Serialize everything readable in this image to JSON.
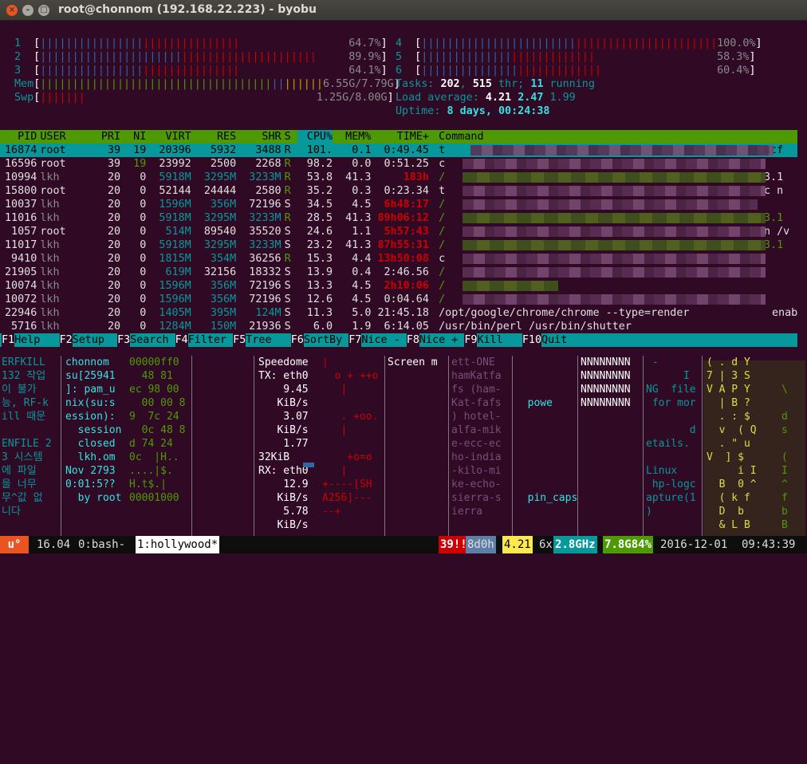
{
  "window": {
    "title": "root@chonnom (192.168.22.223) - byobu"
  },
  "cpu_meters": [
    {
      "label": "1",
      "value": "64.7%",
      "fill": 0.647
    },
    {
      "label": "2",
      "value": "89.9%",
      "fill": 0.899
    },
    {
      "label": "3",
      "value": "64.1%",
      "fill": 0.641
    },
    {
      "label": "4",
      "value": "100.0%",
      "fill": 1.0
    },
    {
      "label": "5",
      "value": "58.3%",
      "fill": 0.583
    },
    {
      "label": "6",
      "value": "60.4%",
      "fill": 0.604
    }
  ],
  "mem": {
    "label": "Mem",
    "value": "6.55G/7.79G"
  },
  "swp": {
    "label": "Swp",
    "value": "1.25G/8.00G"
  },
  "tasks": {
    "label": "Tasks:",
    "count": "202",
    "sep": ",",
    "thr": "515",
    "thr_label": "thr;",
    "running": "11",
    "running_label": "running"
  },
  "load": {
    "label": "Load average:",
    "v1": "4.21",
    "v2": "2.47",
    "v3": "1.99"
  },
  "uptime": {
    "label": "Uptime:",
    "value": "8 days, 00:24:38"
  },
  "columns": [
    "PID",
    "USER",
    "PRI",
    "NI",
    "VIRT",
    "RES",
    "SHR",
    "S",
    "CPU%",
    "MEM%",
    "TIME+",
    "Command"
  ],
  "processes": [
    [
      "16874",
      "root",
      "39",
      "19",
      "20396",
      "5932",
      "3488",
      "R",
      "101.",
      "0.1",
      "0:49.45",
      "t"
    ],
    [
      "16596",
      "root",
      "39",
      "19",
      "23992",
      "2500",
      "2268",
      "R",
      "98.2",
      "0.0",
      "0:51.25",
      "c"
    ],
    [
      "10994",
      "lkh",
      "20",
      "0",
      "5918M",
      "3295M",
      "3233M",
      "R",
      "53.8",
      "41.3",
      "183h",
      "/"
    ],
    [
      "15800",
      "root",
      "20",
      "0",
      "52144",
      "24444",
      "2580",
      "R",
      "35.2",
      "0.3",
      "0:23.34",
      "t"
    ],
    [
      "10037",
      "lkh",
      "20",
      "0",
      "1596M",
      "356M",
      "72196",
      "S",
      "34.5",
      "4.5",
      "6h48:17",
      "/"
    ],
    [
      "11016",
      "lkh",
      "20",
      "0",
      "5918M",
      "3295M",
      "3233M",
      "R",
      "28.5",
      "41.3",
      "89h06:12",
      "/"
    ],
    [
      "1057",
      "root",
      "20",
      "0",
      "514M",
      "89540",
      "35520",
      "S",
      "24.6",
      "1.1",
      "5h57:43",
      "/"
    ],
    [
      "11017",
      "lkh",
      "20",
      "0",
      "5918M",
      "3295M",
      "3233M",
      "S",
      "23.2",
      "41.3",
      "87h55:31",
      "/"
    ],
    [
      "9410",
      "lkh",
      "20",
      "0",
      "1815M",
      "354M",
      "36256",
      "R",
      "15.3",
      "4.4",
      "13h50:08",
      "c"
    ],
    [
      "21905",
      "lkh",
      "20",
      "0",
      "619M",
      "32156",
      "18332",
      "S",
      "13.9",
      "0.4",
      "2:46.56",
      "/"
    ],
    [
      "10074",
      "lkh",
      "20",
      "0",
      "1596M",
      "356M",
      "72196",
      "S",
      "13.3",
      "4.5",
      "2h10:06",
      "/"
    ],
    [
      "10072",
      "lkh",
      "20",
      "0",
      "1596M",
      "356M",
      "72196",
      "S",
      "12.6",
      "4.5",
      "0:04.64",
      "/"
    ],
    [
      "22946",
      "lkh",
      "20",
      "0",
      "1405M",
      "395M",
      "124M",
      "S",
      "11.3",
      "5.0",
      "21:45.18",
      "/opt/google/chrome/chrome --type=render"
    ],
    [
      "5716",
      "lkh",
      "20",
      "0",
      "1284M",
      "150M",
      "21936",
      "S",
      "6.0",
      "1.9",
      "6:14.05",
      "/usr/bin/perl /usr/bin/shutter"
    ]
  ],
  "right_tail": {
    "r0": "utf",
    "r2": "3.1",
    "r3": "c n",
    "r5": "3.1",
    "r6": "n /v",
    "r7": "3.1",
    "r12": "enab"
  },
  "fkeys": [
    {
      "key": "F1",
      "label": "Help"
    },
    {
      "key": "F2",
      "label": "Setup"
    },
    {
      "key": "F3",
      "label": "Search"
    },
    {
      "key": "F4",
      "label": "Filter"
    },
    {
      "key": "F5",
      "label": "Tree"
    },
    {
      "key": "F6",
      "label": "SortBy"
    },
    {
      "key": "F7",
      "label": "Nice -"
    },
    {
      "key": "F8",
      "label": "Nice +"
    },
    {
      "key": "F9",
      "label": "Kill"
    },
    {
      "key": "F10",
      "label": "Quit"
    }
  ],
  "panels": {
    "p1": [
      "ERFKILL",
      "132 작업",
      "이 불가",
      "능, RF-k",
      "ill 때문",
      "",
      "ENFILE 2",
      "3 시스템",
      "에 파일",
      "을 너무",
      "무^값 없",
      "니다"
    ],
    "p2": [
      "chonnom",
      "su[25941",
      "]: pam_u",
      "nix(su:s",
      "ession):",
      "  session",
      "  closed",
      "  lkh.om",
      "Nov 2793",
      "0:01:5??",
      "  by root"
    ],
    "p3": [
      "00000ff0",
      "  48 81",
      "ec 98 00",
      "  00 00 8",
      "9  7c 24",
      "  0c 48 8",
      "d 74 24",
      "0c  |H..",
      "....|$.",
      "H.t$.|",
      "00001000"
    ],
    "p4": [
      "Speedome",
      "TX: eth0",
      "    9.45",
      "   KiB/s",
      "    3.07",
      "   KiB/s",
      "    1.77",
      "32KiB",
      "RX: eth0",
      "    12.9",
      "   KiB/s",
      "    5.78",
      "   KiB/s"
    ],
    "p5": [
      "|",
      "  o + ++o",
      "   |",
      "",
      "   . +oo.",
      "   |",
      "",
      "    +o=o",
      "   |",
      "+----[SH",
      "A256]---",
      "--+"
    ],
    "p6": [
      "Screen m"
    ],
    "p7": [
      "ett-ONE",
      "hamKatfa",
      "fs (ham-",
      "Kat-fafs",
      ") hotel-",
      "alfa-mik",
      "e-ecc-ec",
      "ho-india",
      "-kilo-mi",
      "ke-echo-",
      "sierra-s",
      "ierra"
    ],
    "p8": [
      "",
      "",
      "",
      "  powe",
      "",
      "",
      "",
      "",
      "",
      "",
      "  pin_caps"
    ],
    "p9": [
      "NNNNNNNN",
      "NNNNNNNN",
      "NNNNNNNN",
      "NNNNNNNN"
    ],
    "p10": [
      " -",
      "      I",
      "NG  file",
      " for mor",
      "",
      "       d",
      "etails.",
      "",
      "Linux",
      " hp-logc",
      "apture(1",
      ")"
    ],
    "p11": [
      "( . d Y",
      "7 | 3 S",
      "V A P Y",
      "  | B ?",
      "  . : $",
      "  v  ( Q",
      "  . \" u",
      "V  ] $",
      "     i I",
      "  B  0 ^",
      "  ( k f",
      "  D  b",
      "  & L B"
    ],
    "p12": [
      "",
      "",
      "\\",
      "",
      "d",
      "s",
      "",
      "(",
      "I",
      "^",
      "f",
      "b",
      "B"
    ]
  },
  "statusbar": {
    "logo": "u°",
    "release": "16.04",
    "win0": "0:bash-",
    "win1": "1:hollywood*",
    "updates": "39!!",
    "uptime": "8d0h",
    "load": "4.21",
    "cpu_count": "6x",
    "cpu_freq": "2.8GHz",
    "mem": "7.8G84%",
    "date": "2016-12-01",
    "time": "09:43:39"
  }
}
